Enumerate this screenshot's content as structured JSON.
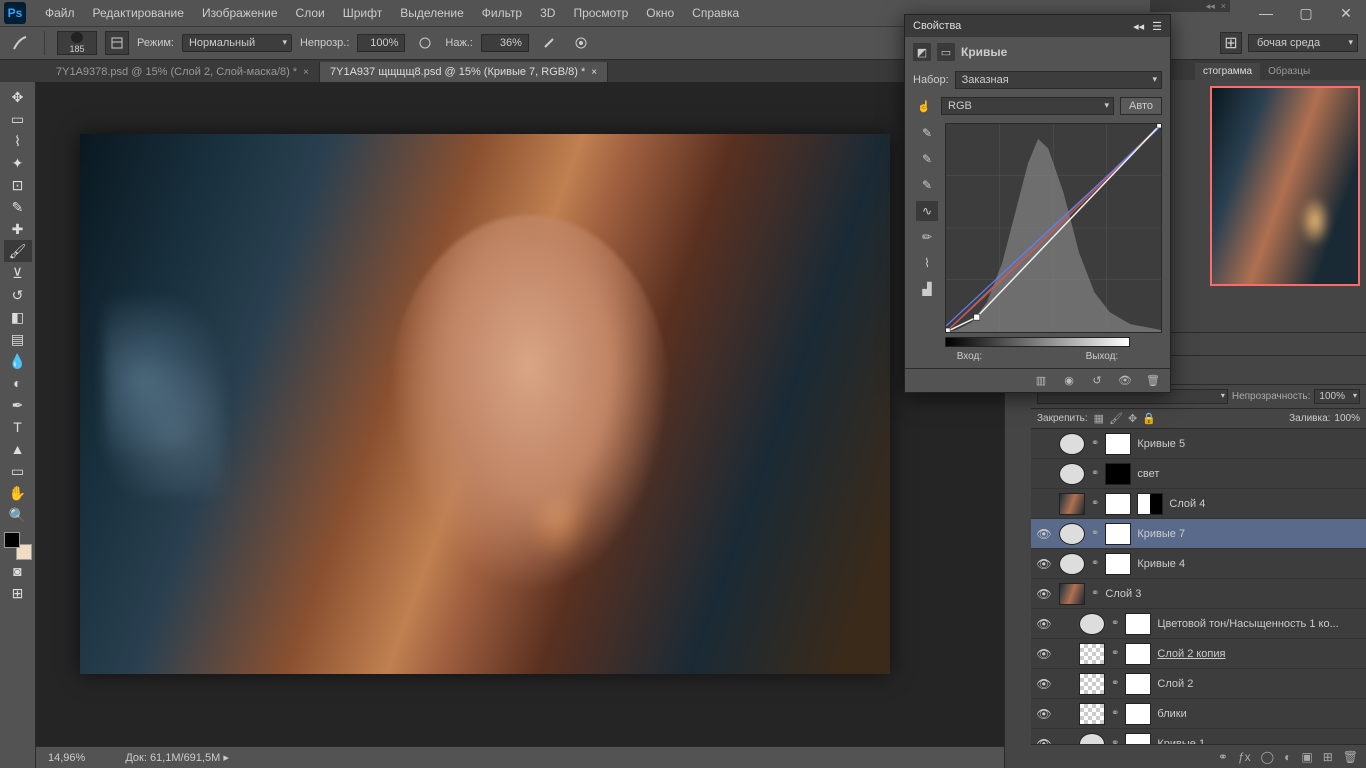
{
  "menu": {
    "items": [
      "Файл",
      "Редактирование",
      "Изображение",
      "Слои",
      "Шрифт",
      "Выделение",
      "Фильтр",
      "3D",
      "Просмотр",
      "Окно",
      "Справка"
    ]
  },
  "options": {
    "brush_size": "185",
    "mode_label": "Режим:",
    "mode_value": "Нормальный",
    "opacity_label": "Непрозр.:",
    "opacity_value": "100%",
    "flow_label": "Наж.:",
    "flow_value": "36%"
  },
  "tabs": {
    "t0": "7Y1A9378.psd @ 15% (Слой 2, Слой-маска/8) *",
    "t1": "7Y1A937 щщщщ8.psd @ 15% (Кривые 7, RGB/8) *"
  },
  "status": {
    "zoom": "14,96%",
    "doc_label": "Док:",
    "doc_value": "61,1M/691,5M"
  },
  "env": "бочая среда",
  "navtabs": {
    "t0": "стограмма",
    "t1": "Образцы"
  },
  "props": {
    "title": "Свойства",
    "subtitle": "Кривые",
    "preset_label": "Набор:",
    "preset_value": "Заказная",
    "channel": "RGB",
    "auto": "Авто",
    "input_label": "Вход:",
    "output_label": "Выход:"
  },
  "layers_panel": {
    "opacity_label": "Непрозрачность:",
    "opacity_value": "100%",
    "fill_label": "Заливка:",
    "fill_value": "100%",
    "lock_label": "Закрепить:",
    "items": [
      {
        "eye": "",
        "adj": true,
        "mask": "white",
        "name": "Кривые 5"
      },
      {
        "eye": "",
        "adj": true,
        "mask": "dark",
        "name": "свет"
      },
      {
        "eye": "",
        "photo": true,
        "mask": "white",
        "name": "Слой 4",
        "maskextra": true
      },
      {
        "eye": "👁",
        "adj": true,
        "mask": "white",
        "name": "Кривые 7",
        "sel": true
      },
      {
        "eye": "👁",
        "adj": true,
        "mask": "white",
        "name": "Кривые 4",
        "maskicon": true
      },
      {
        "eye": "👁",
        "photo": true,
        "name": "Слой 3"
      },
      {
        "eye": "👁",
        "adj": true,
        "mask": "white",
        "indent": true,
        "name": "Цветовой тон/Насыщенность 1 ко..."
      },
      {
        "eye": "👁",
        "checker": true,
        "mask": "white",
        "indent": true,
        "name": "Слой 2 копия",
        "underline": true
      },
      {
        "eye": "👁",
        "checker": true,
        "mask": "white",
        "indent": true,
        "name": "Слой 2"
      },
      {
        "eye": "👁",
        "checker": true,
        "mask": "white",
        "indent": true,
        "name": "блики"
      },
      {
        "eye": "👁",
        "adj": true,
        "mask": "white",
        "indent": true,
        "name": "Кривые 1"
      }
    ]
  },
  "chart_data": {
    "type": "curves",
    "title": "Кривые",
    "channel": "RGB",
    "xlim": [
      0,
      255
    ],
    "ylim": [
      0,
      255
    ],
    "histogram_peak_input": 90,
    "diagonal_baseline": [
      [
        0,
        0
      ],
      [
        255,
        255
      ]
    ],
    "rgb_curve_points": [
      [
        0,
        0
      ],
      [
        36,
        18
      ],
      [
        255,
        255
      ]
    ],
    "red_curve_points": [
      [
        0,
        0
      ],
      [
        130,
        110
      ],
      [
        255,
        255
      ]
    ],
    "blue_curve_points": [
      [
        0,
        8
      ],
      [
        255,
        250
      ]
    ]
  }
}
